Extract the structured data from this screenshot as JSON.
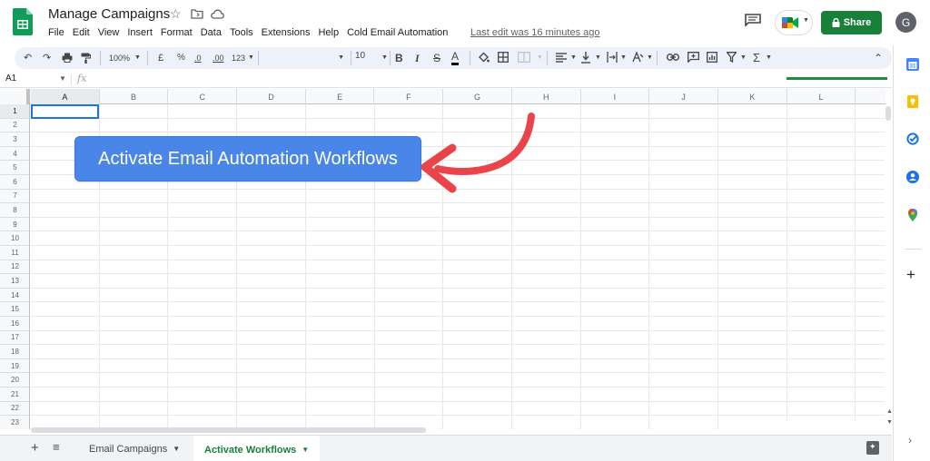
{
  "header": {
    "doc_title": "Manage Campaigns",
    "menu": [
      "File",
      "Edit",
      "View",
      "Insert",
      "Format",
      "Data",
      "Tools",
      "Extensions",
      "Help",
      "Cold Email Automation"
    ],
    "last_edit": "Last edit was 16 minutes ago",
    "share_label": "Share",
    "avatar_initial": "G"
  },
  "toolbar": {
    "zoom": "100%",
    "currency": "£",
    "percent": "%",
    "decrease_decimals": ".0",
    "increase_decimals": ".00",
    "more_formats": "123",
    "font_size": "10",
    "bold": "B",
    "italic": "I",
    "strike": "S",
    "text_color": "A",
    "sum": "Σ"
  },
  "formula_bar": {
    "name_box": "A1",
    "fx": "fx"
  },
  "grid": {
    "columns": [
      "A",
      "B",
      "C",
      "D",
      "E",
      "F",
      "G",
      "H",
      "I",
      "J",
      "K",
      "L"
    ],
    "rows": [
      "1",
      "2",
      "3",
      "4",
      "5",
      "6",
      "7",
      "8",
      "9",
      "10",
      "11",
      "12",
      "13",
      "14",
      "15",
      "16",
      "17",
      "18",
      "19",
      "20",
      "21",
      "22",
      "23"
    ],
    "active_cell": "A1"
  },
  "overlay": {
    "button_label": "Activate Email Automation Workflows"
  },
  "sheets": {
    "tabs": [
      {
        "label": "Email Campaigns",
        "active": false
      },
      {
        "label": "Activate Workflows",
        "active": true
      }
    ]
  },
  "colors": {
    "brand_green": "#188038",
    "button_blue": "#4a86e8",
    "arrow_red": "#e8444a"
  }
}
